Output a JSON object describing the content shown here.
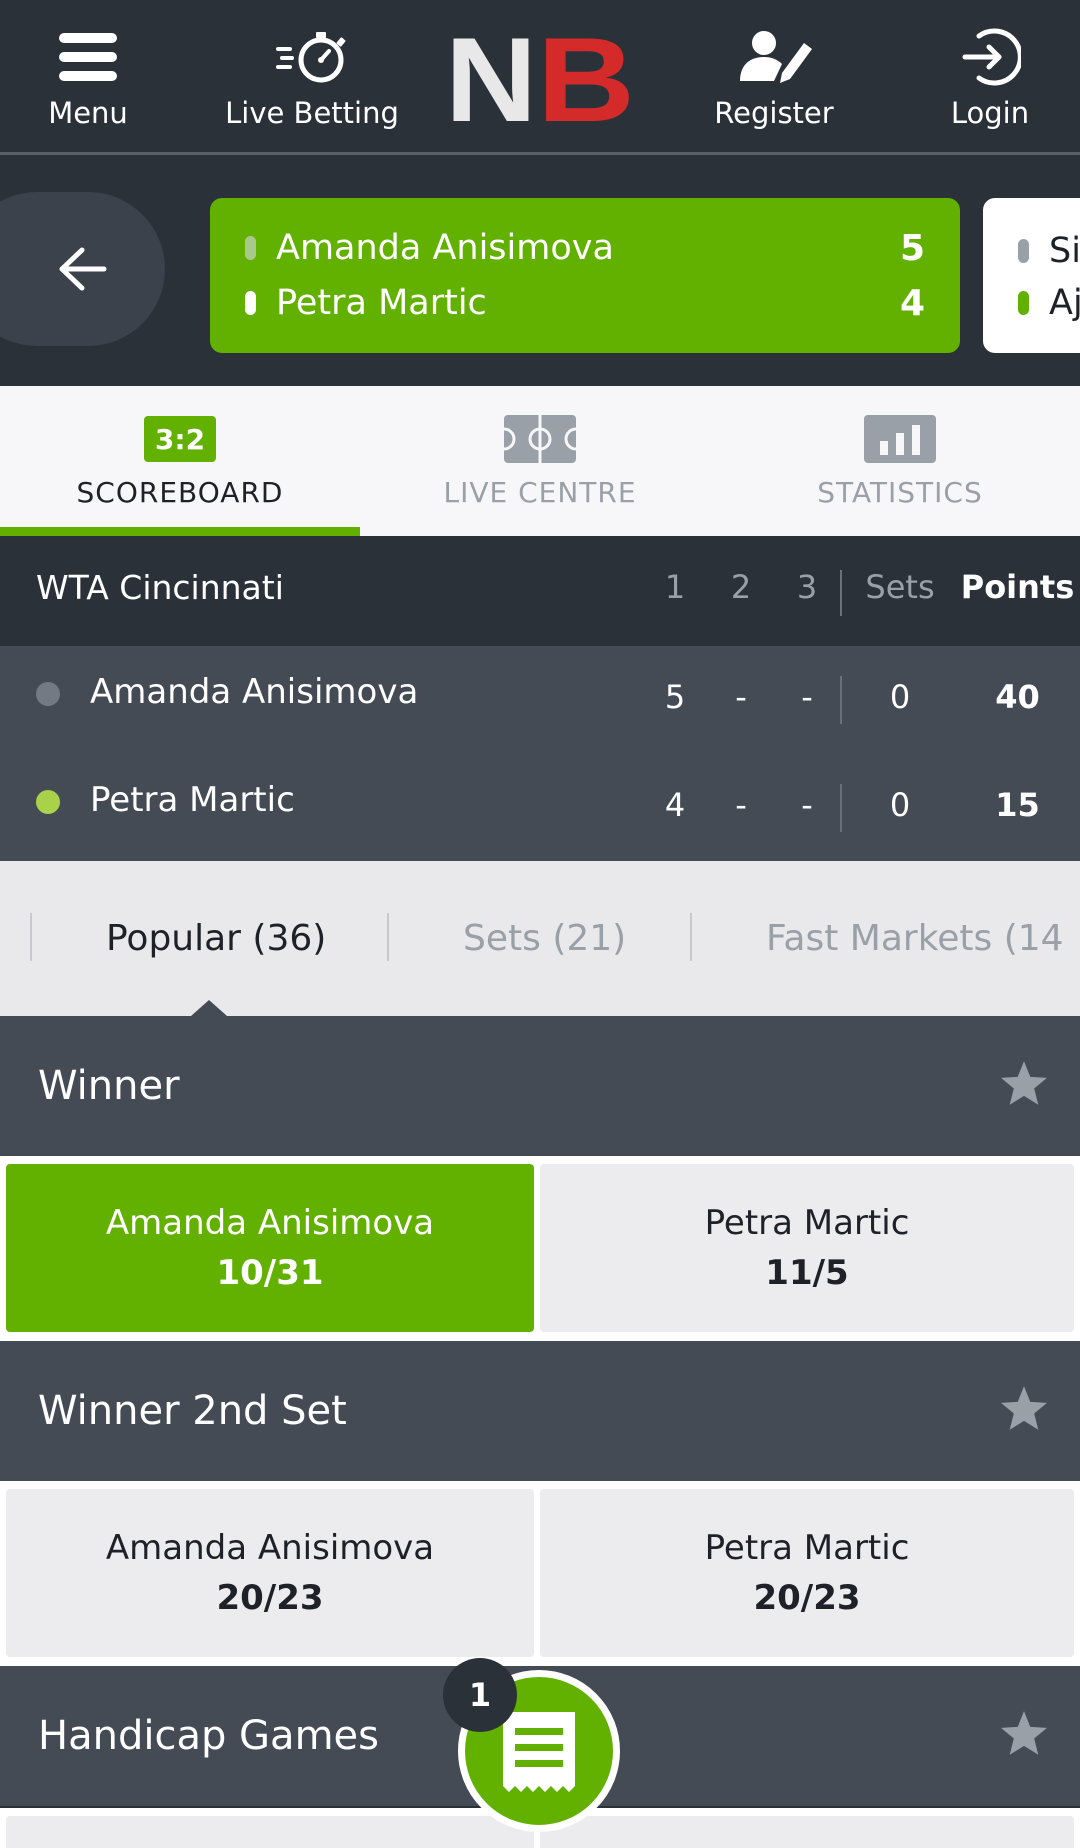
{
  "header": {
    "menu_label": "Menu",
    "live_label": "Live Betting",
    "register_label": "Register",
    "login_label": "Login",
    "logo_letters": "NB",
    "colors": {
      "background": "#2b3139",
      "logo_red": "#d42a2a",
      "logo_white": "#e8e8e8"
    }
  },
  "live_strip": {
    "current": {
      "player1": "Amanda Anisimova",
      "player2": "Petra Martic",
      "score1": "5",
      "score2": "4"
    },
    "next_peek": {
      "player1": "Si",
      "player2": "Aj"
    },
    "colors": {
      "accent": "#62b000"
    }
  },
  "tabs": [
    {
      "label": "SCOREBOARD",
      "badge": "3:2"
    },
    {
      "label": "LIVE CENTRE"
    },
    {
      "label": "STATISTICS"
    }
  ],
  "scoreboard": {
    "tournament": "WTA Cincinnati",
    "cols": [
      "1",
      "2",
      "3",
      "Sets",
      "Points"
    ],
    "rows": [
      {
        "name": "Amanda Anisimova",
        "s1": "5",
        "s2": "-",
        "s3": "-",
        "sets": "0",
        "points": "40",
        "serving": false
      },
      {
        "name": "Petra Martic",
        "s1": "4",
        "s2": "-",
        "s3": "-",
        "sets": "0",
        "points": "15",
        "serving": true
      }
    ]
  },
  "filters": [
    {
      "label": "Popular (36)"
    },
    {
      "label": "Sets (21)"
    },
    {
      "label": "Fast Markets (14"
    }
  ],
  "markets": [
    {
      "title": "Winner",
      "odds": [
        {
          "name": "Amanda Anisimova",
          "value": "10/31"
        },
        {
          "name": "Petra Martic",
          "value": "11/5"
        }
      ]
    },
    {
      "title": "Winner 2nd Set",
      "odds": [
        {
          "name": "Amanda Anisimova",
          "value": "20/23"
        },
        {
          "name": "Petra Martic",
          "value": "20/23"
        }
      ]
    },
    {
      "title": "Handicap Games"
    }
  ],
  "betslip": {
    "count": "1"
  }
}
